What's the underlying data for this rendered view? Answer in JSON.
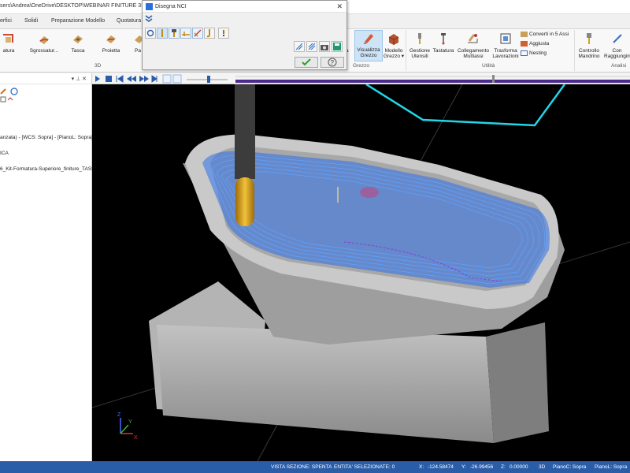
{
  "window": {
    "path": "sers\\Andrea\\OneDrive\\DESKTOP\\WEBINAR  FINITURE 3D a pa"
  },
  "ribbon_tabs": [
    "erfici",
    "Solidi",
    "Preparazione Modello",
    "Quotatura"
  ],
  "ribbon": {
    "left_buttons": [
      {
        "label": "atura",
        "icon": "contour-icon"
      },
      {
        "label": "Sgrossatur...",
        "icon": "roughing-icon"
      },
      {
        "label": "Tasca",
        "icon": "pocket-icon"
      },
      {
        "label": "Proietta",
        "icon": "project-icon"
      },
      {
        "label": "Pa",
        "icon": "parallel-icon"
      }
    ],
    "group_3d": "3D",
    "stock_buttons": [
      {
        "label": "tura",
        "icon": "contour-icon"
      },
      {
        "label": "Visualizza\nGrezzo",
        "icon": "show-stock-icon"
      },
      {
        "label": "Modello\nGrezzo ▾",
        "icon": "stock-model-icon"
      }
    ],
    "group_grezzo": "Grezzo",
    "utility_buttons": [
      {
        "label": "Gestione\nUtensili",
        "icon": "tool-manager-icon"
      },
      {
        "label": "Tastatura",
        "icon": "probe-icon"
      },
      {
        "label": "Collegamento\nMultiassi",
        "icon": "multiaxis-link-icon"
      },
      {
        "label": "Trasforma\nLavorazioni",
        "icon": "transform-icon"
      }
    ],
    "utility_small": [
      {
        "label": "Converti in 5 Assi",
        "icon": "convert-5axis-icon"
      },
      {
        "label": "Aggiusta",
        "icon": "trim-icon"
      },
      {
        "label": "Nesting",
        "icon": "nesting-icon"
      }
    ],
    "group_utilita": "Utilità",
    "analysis_buttons": [
      {
        "label": "Controllo\nMandrino",
        "icon": "holder-check-icon"
      },
      {
        "label": "Con\nRaggiungim",
        "icon": "reach-check-icon"
      }
    ],
    "group_analisi": "Analisi"
  },
  "left_panel": {
    "pin_glyphs": "▾  ⊥  ✕",
    "lines": [
      "anzata) - [WCS: Sopra] - [PianoL: Sopra]",
      "ICA",
      "6_Kit-Formatura-Superiore_finiture_TASI"
    ]
  },
  "dialog": {
    "title": "Disegna NCI",
    "close": "✕",
    "ok_icon": "checkmark-icon",
    "help_icon": "help-icon"
  },
  "status": {
    "section": "VISTA SEZIONE: SPENTA",
    "selected": "ENTITA' SELEZIONATE: 0",
    "x_label": "X:",
    "x": "-124.58474",
    "y_label": "Y:",
    "y": "-26.99456",
    "z_label": "Z:",
    "z": "0.00000",
    "mode": "3D",
    "planec": "PianoC: Sopra",
    "planel": "PianoL: Sopra"
  },
  "colors": {
    "toolpath": "#2f6fe8",
    "stock": "#9a9a9a",
    "tool": "#d8a21a",
    "statusbar": "#2a5da8",
    "cyan": "#22d6e8",
    "progress": "#4b2c8c"
  },
  "triad": {
    "x": "X",
    "y": "Y",
    "z": "Z"
  }
}
